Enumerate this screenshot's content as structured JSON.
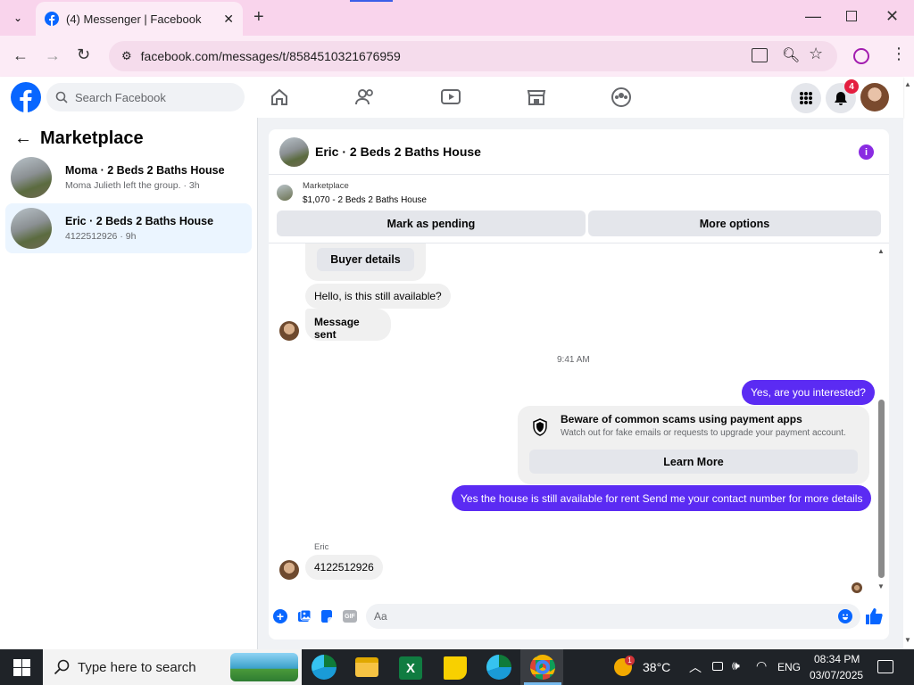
{
  "browser": {
    "tab_title": "(4) Messenger | Facebook",
    "url": "facebook.com/messages/t/8584510321676959"
  },
  "fb": {
    "search_placeholder": "Search Facebook",
    "notif_count": "4"
  },
  "sidebar": {
    "title": "Marketplace",
    "items": [
      {
        "title": "Moma · 2 Beds 2 Baths House",
        "sub": "Moma Julieth left the group. · 3h"
      },
      {
        "title": "Eric · 2 Beds 2 Baths House",
        "sub": "4122512926 · 9h"
      }
    ]
  },
  "chat": {
    "header": "Eric · 2 Beds 2 Baths House",
    "listing_label": "Marketplace",
    "listing_price": "$1,070 - 2 Beds 2 Baths House",
    "mark_pending": "Mark as pending",
    "more_options": "More options",
    "buyer_details": "Buyer details",
    "msg1": "Hello, is this still available?",
    "msg2": "Message sent",
    "time": "9:41 AM",
    "msg3": "Yes, are you interested?",
    "scam_title": "Beware of common scams using payment apps",
    "scam_sub": "Watch out for fake emails or requests to upgrade your payment account.",
    "learn_more": "Learn More",
    "msg4": "Yes the house is still available for rent Send me your contact number for more details",
    "sender": "Eric",
    "msg5": "4122512926",
    "composer_placeholder": "Aa",
    "gif": "GIF"
  },
  "taskbar": {
    "search": "Type here to search",
    "temp": "38°C",
    "lang": "ENG",
    "time": "08:34 PM",
    "date": "03/07/2025",
    "weather_badge": "1"
  },
  "colors": {
    "accent": "#5b2bf3",
    "fb_blue": "#0866ff"
  }
}
